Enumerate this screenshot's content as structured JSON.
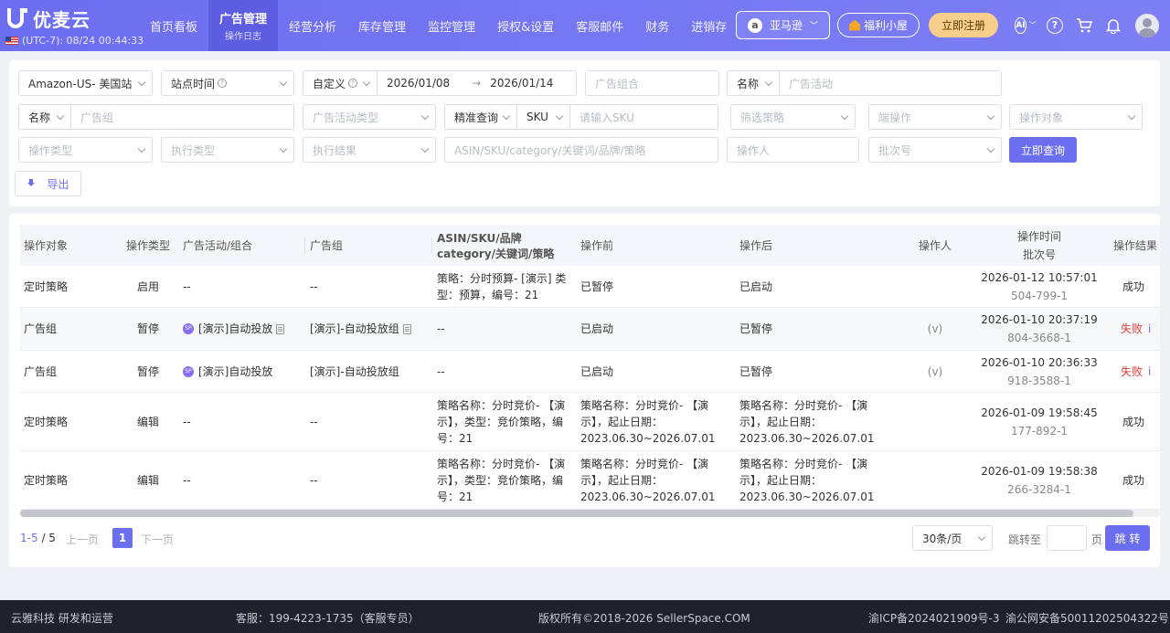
{
  "header": {
    "logo_text": "优麦云",
    "timezone": "(UTC-7): 08/24 00:44:33",
    "nav": [
      {
        "label": "首页看板",
        "sub": ""
      },
      {
        "label": "广告管理",
        "sub": "操作日志"
      },
      {
        "label": "经营分析",
        "sub": ""
      },
      {
        "label": "库存管理",
        "sub": ""
      },
      {
        "label": "监控管理",
        "sub": ""
      },
      {
        "label": "授权&设置",
        "sub": ""
      },
      {
        "label": "客服邮件",
        "sub": ""
      },
      {
        "label": "财务",
        "sub": ""
      },
      {
        "label": "进销存",
        "sub": ""
      }
    ],
    "store_label": "亚马逊",
    "welfare_label": "福利小屋",
    "register_label": "立即注册",
    "ai_label": "AI"
  },
  "filters": {
    "site": "Amazon-US- 美国站",
    "time_type": "站点时间",
    "range_mode": "自定义",
    "date_start": "2026/01/08",
    "date_sep": "→",
    "date_end": "2026/01/14",
    "campaign_group_ph": "广告组合",
    "name_select_1": "名称",
    "campaign_ph": "广告活动",
    "name_select_2": "名称",
    "adgroup_ph": "广告组",
    "campaign_type_ph": "广告活动类型",
    "match_mode": "精准查询",
    "sku_select": "SKU",
    "sku_ph": "请输入SKU",
    "strategy_ph": "筛选策略",
    "terminal_ph": "端操作",
    "target_ph": "操作对象",
    "op_type_ph": "操作类型",
    "exec_type_ph": "执行类型",
    "exec_result_ph": "执行结果",
    "keyword_ph": "ASIN/SKU/category/关键词/品牌/策略",
    "operator_ph": "操作人",
    "batch_ph": "批次号",
    "query_label": "立即查询",
    "export_label": "导出"
  },
  "table": {
    "headers": {
      "target": "操作对象",
      "type": "操作类型",
      "campaign": "广告活动/组合",
      "adgroup": "广告组",
      "asin_1": "ASIN/SKU/品牌",
      "asin_2": "category/关键词/策略",
      "before": "操作前",
      "after": "操作后",
      "operator": "操作人",
      "time_1": "操作时间",
      "time_2": "批次号",
      "result": "操作结果"
    },
    "rows": [
      {
        "target": "定时策略",
        "type": "启用",
        "campaign": "--",
        "adgroup": "--",
        "asin": "策略：分时预算- [演示] 类型：预算，编号：21",
        "before": "已暂停",
        "after": "已启动",
        "operator": "",
        "time": "2026-01-12 10:57:01",
        "batch": "504-799-1",
        "result": "成功"
      },
      {
        "target": "广告组",
        "type": "暂停",
        "campaign": "[演示]自动投放",
        "adgroup": "[演示]-自动投放组",
        "asin": "--",
        "before": "已启动",
        "after": "已暂停",
        "operator": "(v)",
        "time": "2026-01-10 20:37:19",
        "batch": "804-3668-1",
        "result": "失败"
      },
      {
        "target": "广告组",
        "type": "暂停",
        "campaign": "[演示]自动投放",
        "adgroup": "[演示]-自动投放组",
        "asin": "--",
        "before": "已启动",
        "after": "已暂停",
        "operator": "(v)",
        "time": "2026-01-10 20:36:33",
        "batch": "918-3588-1",
        "result": "失败"
      },
      {
        "target": "定时策略",
        "type": "编辑",
        "campaign": "--",
        "adgroup": "--",
        "asin": "策略名称：分时竞价- 【演示】，类型：竞价策略，编号：21",
        "before": "策略名称：分时竞价- 【演示】，起止日期：2023.06.30~2026.07.01",
        "after": "策略名称：分时竞价- 【演示】，起止日期：2023.06.30~2026.07.01",
        "operator": "",
        "time": "2026-01-09 19:58:45",
        "batch": "177-892-1",
        "result": "成功"
      },
      {
        "target": "定时策略",
        "type": "编辑",
        "campaign": "--",
        "adgroup": "--",
        "asin": "策略名称：分时竞价- 【演示】，类型：竞价策略，编号：21",
        "before": "策略名称：分时竞价- 【演示】，起止日期：2023.06.30~2026.07.01",
        "after": "策略名称：分时竞价- 【演示】，起止日期：2023.06.30~2026.07.01",
        "operator": "",
        "time": "2026-01-09 19:58:38",
        "batch": "266-3284-1",
        "result": "成功"
      }
    ]
  },
  "pagination": {
    "range": "1-5",
    "total": "/ 5",
    "prev": "上一页",
    "current": "1",
    "next": "下一页",
    "page_size": "30条/页",
    "goto": "跳转至",
    "page_unit": "页",
    "jump": "跳 转"
  },
  "footer": {
    "company": "云雅科技 研发和运营",
    "service": "客服：199-4223-1735（客服专员）",
    "copyright": "版权所有©2018-2026 SellerSpace.COM",
    "icp": "渝ICP备2024021909号-3",
    "police": "渝公网安备50011202504322号"
  },
  "colors": {
    "brand": "#6c6ef0",
    "fail": "#e53935"
  }
}
